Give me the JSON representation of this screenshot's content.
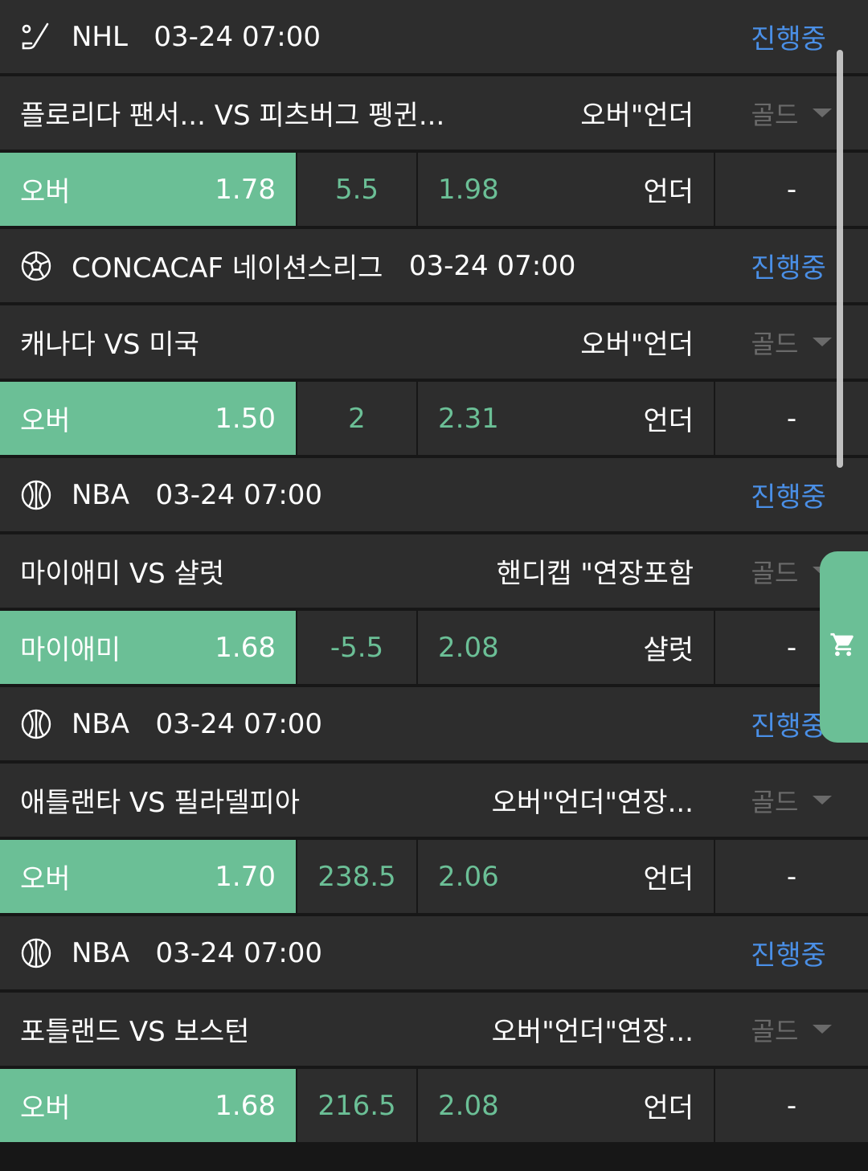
{
  "colors": {
    "accent_green": "#6bbf96",
    "status_blue": "#4a8fe6",
    "row_bg": "#2d2d2d",
    "divider": "#171717"
  },
  "games": [
    {
      "sport_icon": "hockey-icon",
      "league": "NHL",
      "datetime": "03-24 07:00",
      "status": "진행중",
      "home": "플로리다 팬서...",
      "vs": "VS",
      "away": "피츠버그 펭귄...",
      "market": "오버\"언더",
      "gold": "골드",
      "left_label": "오버",
      "left_odds": "1.78",
      "line": "5.5",
      "right_odds": "1.98",
      "right_label": "언더",
      "result": "-"
    },
    {
      "sport_icon": "soccer-icon",
      "league": "CONCACAF 네이션스리그",
      "datetime": "03-24 07:00",
      "status": "진행중",
      "home": "캐나다",
      "vs": "VS",
      "away": "미국",
      "market": "오버\"언더",
      "gold": "골드",
      "left_label": "오버",
      "left_odds": "1.50",
      "line": "2",
      "right_odds": "2.31",
      "right_label": "언더",
      "result": "-"
    },
    {
      "sport_icon": "basketball-icon",
      "league": "NBA",
      "datetime": "03-24 07:00",
      "status": "진행중",
      "home": "마이애미",
      "vs": "VS",
      "away": "샬럿",
      "market": "핸디캡 \"연장포함",
      "gold": "골드",
      "left_label": "마이애미",
      "left_odds": "1.68",
      "line": "-5.5",
      "right_odds": "2.08",
      "right_label": "샬럿",
      "result": "-"
    },
    {
      "sport_icon": "basketball-icon",
      "league": "NBA",
      "datetime": "03-24 07:00",
      "status": "진행중",
      "home": "애틀랜타",
      "vs": "VS",
      "away": "필라델피아",
      "market": "오버\"언더\"연장...",
      "gold": "골드",
      "left_label": "오버",
      "left_odds": "1.70",
      "line": "238.5",
      "right_odds": "2.06",
      "right_label": "언더",
      "result": "-"
    },
    {
      "sport_icon": "basketball-icon",
      "league": "NBA",
      "datetime": "03-24 07:00",
      "status": "진행중",
      "home": "포틀랜드",
      "vs": "VS",
      "away": "보스턴",
      "market": "오버\"언더\"연장...",
      "gold": "골드",
      "left_label": "오버",
      "left_odds": "1.68",
      "line": "216.5",
      "right_odds": "2.08",
      "right_label": "언더",
      "result": "-"
    }
  ],
  "cart_icon": "cart-icon"
}
